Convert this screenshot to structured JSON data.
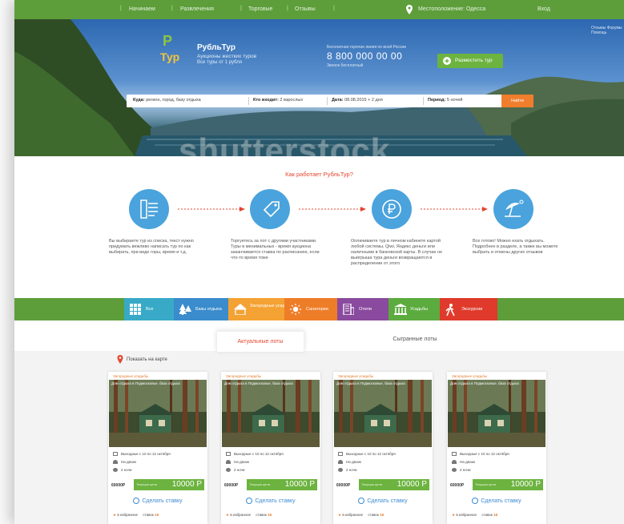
{
  "topnav": {
    "items": [
      "Начинаем",
      "Развлечения",
      "Торговые",
      "Отзывы"
    ],
    "location": "Местоположение: Одесса",
    "login": "Вход"
  },
  "header": {
    "brand": "РубльТур",
    "tagline1": "Аукционы жестких туров",
    "tagline2": "Все туры от 1 рубля",
    "phone_caption": "Бесплатная горячая линия по всей России",
    "phone": "8 800 000 00 00",
    "phone_sub": "Звонок бесплатный",
    "add_button": "Разместить тур",
    "corner_note": "Отзывы Форумы Помощь"
  },
  "search": {
    "where_label": "Куда:",
    "where_value": "регион, город, базу отдыха",
    "who_label": "Кто входит:",
    "who_value": "2 взрослых",
    "date_label": "Дата:",
    "date_value": "08.08.2015 + 2 дня",
    "period_label": "Период:",
    "period_value": "5 ночей",
    "button": "Найти"
  },
  "watermark": "shutterstock",
  "how": {
    "title": "Как работает РубльТур?",
    "steps": [
      {
        "icon": "hotel-form-icon",
        "text": "Вы выбираете тур из списка, текст нужно придумать вежливо написать тур по как выбирать, при виде горы, время и т.д."
      },
      {
        "icon": "tag-icon",
        "text": "Торгуетесь за лот с другими участниками. Туры в минимальных - время аукциона заканчивается ставка по расписанию, если что-то время тоже"
      },
      {
        "icon": "ruble-icon",
        "text": "Оплачиваете тур в личном кабинете картой любой системы, Qiwi, Яндекс деньги или наличными в банковской карты. В случае не выигрыша тура деньги возвращаются в распределении от этого"
      },
      {
        "icon": "beach-umbrella-icon",
        "text": "Все готово! Можно ехать отдыхать. Подробнее в разделе, а также вы можете выбрать и отмены других отзывов"
      }
    ]
  },
  "categories": [
    {
      "label": "Все",
      "color": "#38aac7",
      "icon": "grid-icon"
    },
    {
      "label": "Базы отдыха",
      "color": "#3a8ccc",
      "icon": "trees-icon"
    },
    {
      "label": "Загородные усадьбы",
      "color": "#f4a233",
      "icon": "house-icon"
    },
    {
      "label": "Санатории",
      "color": "#ee7d28",
      "icon": "sun-icon"
    },
    {
      "label": "Отели",
      "color": "#8a4a9e",
      "icon": "hotel-icon"
    },
    {
      "label": "Усадьбы",
      "color": "#5cab3f",
      "icon": "columns-icon"
    },
    {
      "label": "Экскурсии",
      "color": "#df3a2c",
      "icon": "hiker-icon"
    }
  ],
  "tabs": {
    "active": "Актуальные лоты",
    "other": "Сыгранные лоты"
  },
  "map_link": "Показать на карте",
  "cards": [
    {
      "category": "Загородные усадьбы",
      "caption": "Дом отдыха в Подмосковье, база отдыха",
      "dates": "Выходные с 10 по 12 октября",
      "people": "На двоих",
      "nights": "2 ночи",
      "old_price": "60000Р",
      "price_label": "Текущая цена",
      "price": "10000 Р",
      "bid": "Сделать ставку",
      "in_favorites": "в избранное",
      "bids_label": "ставок",
      "bids": "16"
    },
    {
      "category": "Загородные усадьбы",
      "caption": "Дом отдыха в Подмосковье, база отдыха",
      "dates": "Выходные с 10 по 12 октября",
      "people": "На двоих",
      "nights": "2 ночи",
      "old_price": "60000Р",
      "price_label": "Текущая цена",
      "price": "10000 Р",
      "bid": "Сделать ставку",
      "in_favorites": "в избранное",
      "bids_label": "ставок",
      "bids": "16"
    },
    {
      "category": "Загородные усадьбы",
      "caption": "Дом отдыха в Подмосковье, база отдыха",
      "dates": "Выходные с 10 по 12 октября",
      "people": "На двоих",
      "nights": "2 ночи",
      "old_price": "60000Р",
      "price_label": "Текущая цена",
      "price": "10000 Р",
      "bid": "Сделать ставку",
      "in_favorites": "в избранное",
      "bids_label": "ставок",
      "bids": "16"
    },
    {
      "category": "Загородные усадьбы",
      "caption": "Дом отдыха в Подмосковье, база отдыха",
      "dates": "Выходные с 10 по 12 октября",
      "people": "На двоих",
      "nights": "2 ночи",
      "old_price": "60000Р",
      "price_label": "Текущая цена",
      "price": "10000 Р",
      "bid": "Сделать ставку",
      "in_favorites": "в избранное",
      "bids_label": "ставок",
      "bids": "16"
    }
  ],
  "colors": {
    "brand_green": "#5d9e3b",
    "button_green": "#6cb33f",
    "accent_orange": "#f07e2d",
    "accent_red": "#e4462f",
    "step_blue": "#4aa3dc",
    "link_blue": "#3b8ad1"
  }
}
